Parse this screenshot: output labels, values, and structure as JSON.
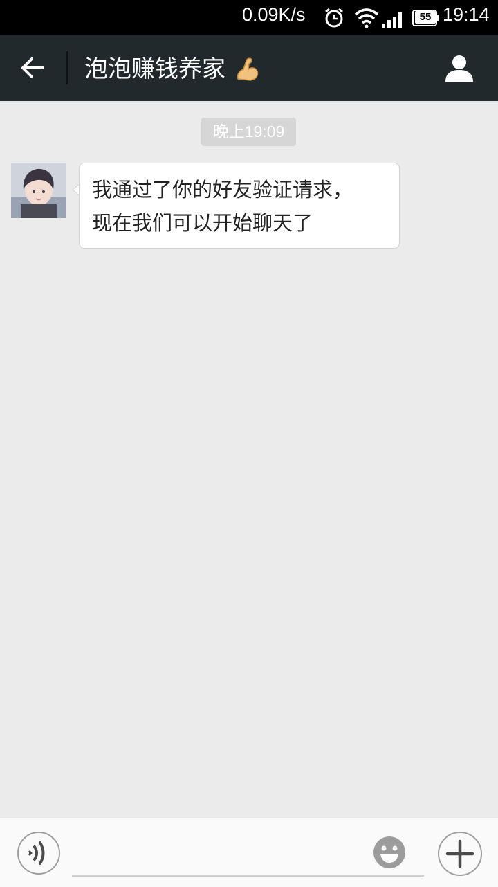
{
  "status_bar": {
    "net_speed": "0.09K/s",
    "battery_level": "55",
    "time": "19:14",
    "icons": [
      "alarm-icon",
      "wifi-icon",
      "signal-icon",
      "battery-icon"
    ]
  },
  "header": {
    "title": "泡泡赚钱养家",
    "title_emoji": "flexed-biceps-emoji",
    "back_icon": "back-arrow-icon",
    "contact_icon": "person-icon",
    "background": "#22292c"
  },
  "conversation": {
    "timestamp": "晚上19:09",
    "messages": [
      {
        "direction": "incoming",
        "avatar": "contact-avatar-photo",
        "lines": [
          "我通过了你的好友验证请求，",
          "现在我们可以开始聊天了"
        ]
      }
    ]
  },
  "input_bar": {
    "voice_icon": "voice-input-icon",
    "input_value": "",
    "emoji_icon": "smiley-icon",
    "more_icon": "plus-icon"
  },
  "colors": {
    "chat_background": "#ebebeb",
    "bubble": "#ffffff",
    "timestamp_pill": "#d6d6d6"
  }
}
